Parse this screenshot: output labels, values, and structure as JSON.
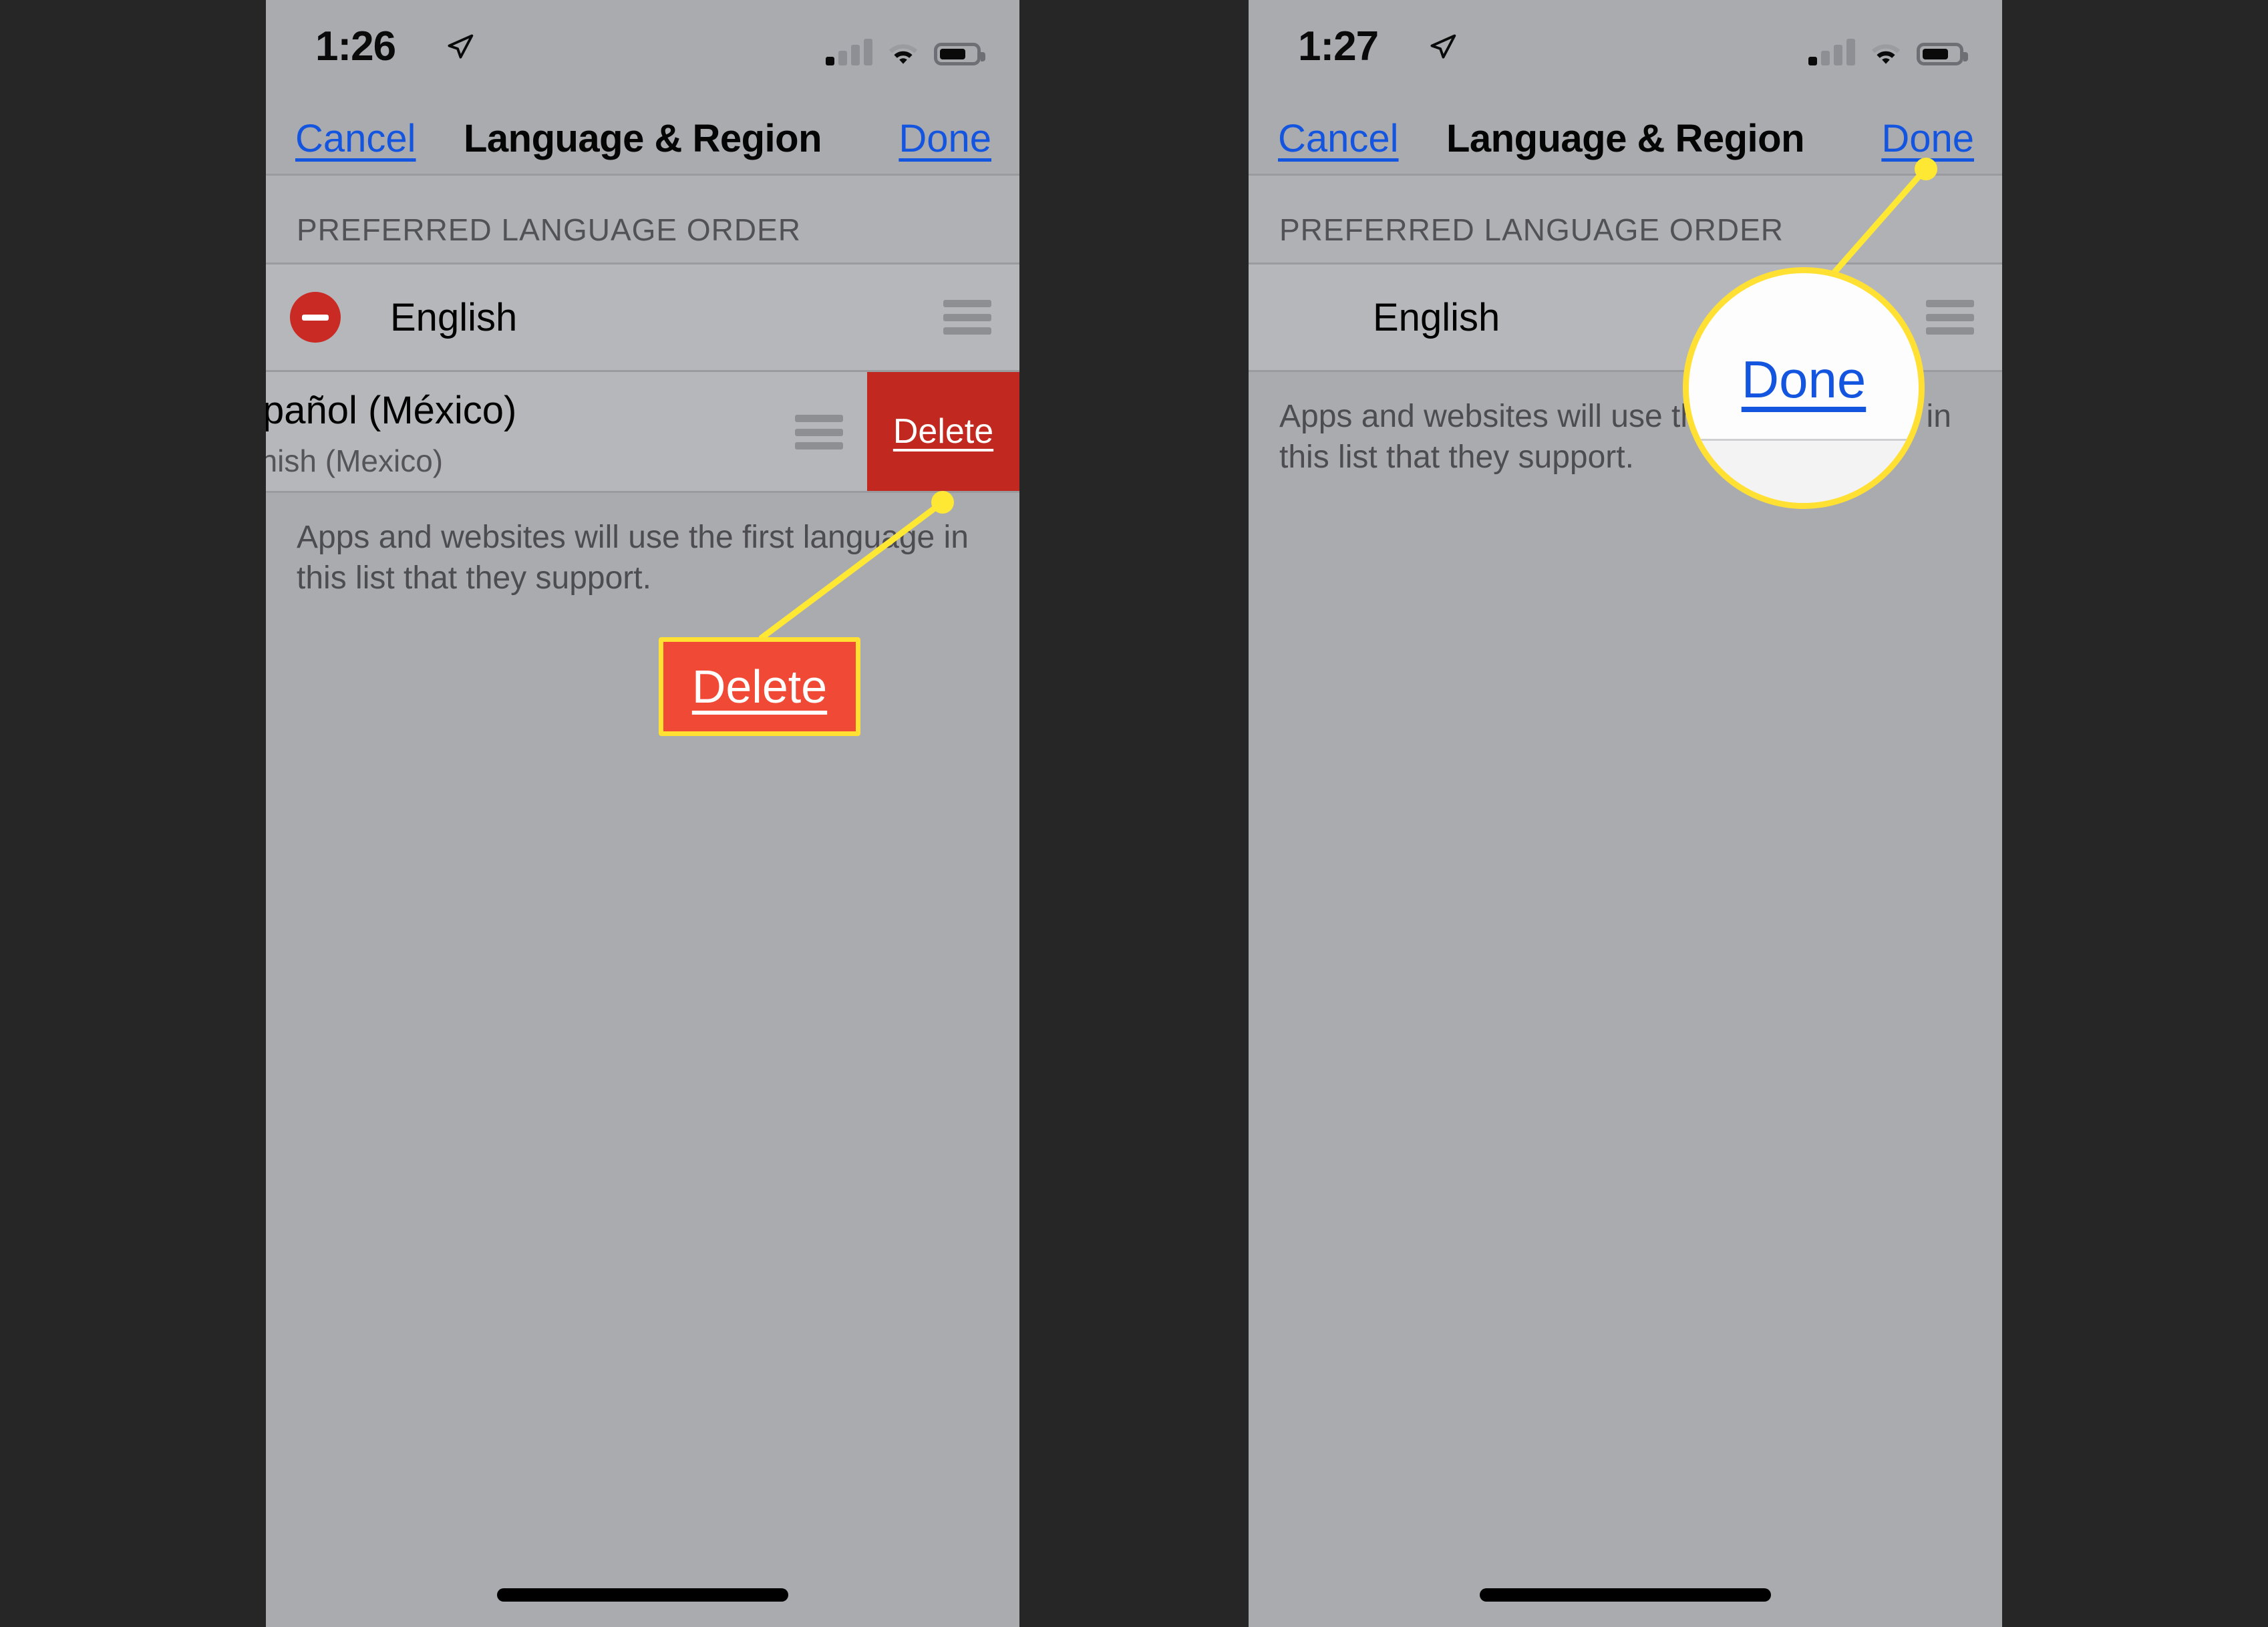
{
  "background_color": "#262626",
  "phones": [
    {
      "id": "left",
      "status": {
        "time": "1:26",
        "location_icon": "location-arrow-icon",
        "signal_icon": "cellular-signal-icon",
        "wifi_icon": "wifi-icon",
        "battery_icon": "battery-icon"
      },
      "nav": {
        "cancel_label": "Cancel",
        "title": "Language & Region",
        "done_label": "Done"
      },
      "section_header": "PREFERRED LANGUAGE ORDER",
      "rows": [
        {
          "label": "English",
          "sub": "",
          "has_minus": true,
          "swiped": false,
          "delete_label": ""
        },
        {
          "label": "spañol (México)",
          "sub": "anish (Mexico)",
          "has_minus": false,
          "swiped": true,
          "delete_label": "Delete"
        }
      ],
      "footnote": "Apps and websites will use the first language in this list that they support."
    },
    {
      "id": "right",
      "status": {
        "time": "1:27",
        "location_icon": "location-arrow-icon",
        "signal_icon": "cellular-signal-icon",
        "wifi_icon": "wifi-icon",
        "battery_icon": "battery-icon"
      },
      "nav": {
        "cancel_label": "Cancel",
        "title": "Language & Region",
        "done_label": "Done"
      },
      "section_header": "PREFERRED LANGUAGE ORDER",
      "rows": [
        {
          "label": "English",
          "sub": "",
          "has_minus": false,
          "swiped": false,
          "delete_label": ""
        }
      ],
      "footnote": "Apps and websites will use the first language in this list that they support."
    }
  ],
  "annotations": {
    "callout_delete": {
      "label": "Delete",
      "box_color": "#f04a37",
      "border_color": "#ffe033",
      "text_color": "#ffffff"
    },
    "magnifier_done": {
      "label": "Done",
      "border_color": "#ffe033",
      "fill_color": "#fdfdfd",
      "text_color": "#1455e0"
    },
    "leader_color": "#ffe833"
  },
  "colors": {
    "phone_body": "#aaabaf",
    "list_row": "#b6b7bb",
    "section_band": "#b0b1b5",
    "accent_blue": "#1455e0",
    "delete_red": "#c1281f",
    "minus_red": "#c92a23",
    "yellow": "#ffe033"
  }
}
